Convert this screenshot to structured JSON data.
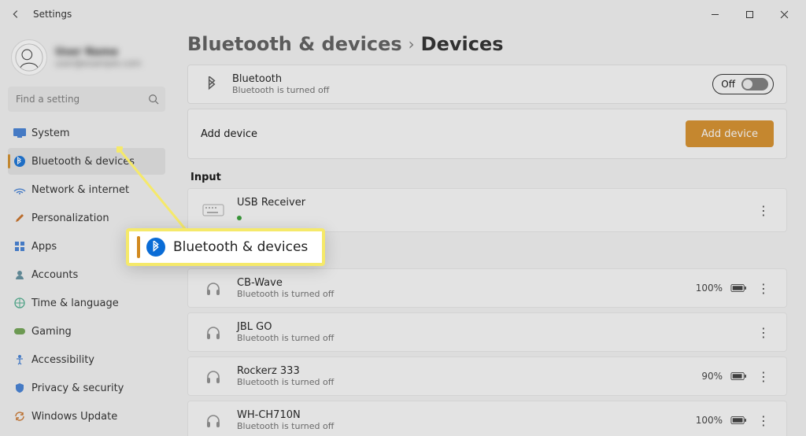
{
  "window": {
    "title": "Settings"
  },
  "profile": {
    "name": "User Name",
    "email": "user@example.com"
  },
  "search": {
    "placeholder": "Find a setting"
  },
  "sidebar": {
    "items": [
      {
        "label": "System"
      },
      {
        "label": "Bluetooth & devices"
      },
      {
        "label": "Network & internet"
      },
      {
        "label": "Personalization"
      },
      {
        "label": "Apps"
      },
      {
        "label": "Accounts"
      },
      {
        "label": "Time & language"
      },
      {
        "label": "Gaming"
      },
      {
        "label": "Accessibility"
      },
      {
        "label": "Privacy & security"
      },
      {
        "label": "Windows Update"
      }
    ],
    "active_index": 1
  },
  "breadcrumb": {
    "parent": "Bluetooth & devices",
    "current": "Devices"
  },
  "bluetooth_card": {
    "title": "Bluetooth",
    "subtitle": "Bluetooth is turned off",
    "toggle_label": "Off",
    "toggle_state": false
  },
  "add_row": {
    "label": "Add device",
    "button": "Add device"
  },
  "sections": [
    {
      "heading": "Input",
      "devices": [
        {
          "name": "USB Receiver",
          "status": "connected_dot",
          "icon": "keyboard",
          "battery": null
        }
      ]
    },
    {
      "heading": "",
      "devices": [
        {
          "name": "CB-Wave",
          "status": "Bluetooth is turned off",
          "icon": "headphones",
          "battery": "100%"
        },
        {
          "name": "JBL GO",
          "status": "Bluetooth is turned off",
          "icon": "headphones",
          "battery": null
        },
        {
          "name": "Rockerz 333",
          "status": "Bluetooth is turned off",
          "icon": "headphones",
          "battery": "90%"
        },
        {
          "name": "WH-CH710N",
          "status": "Bluetooth is turned off",
          "icon": "headphones",
          "battery": "100%"
        }
      ]
    }
  ],
  "callout": {
    "label": "Bluetooth & devices"
  }
}
